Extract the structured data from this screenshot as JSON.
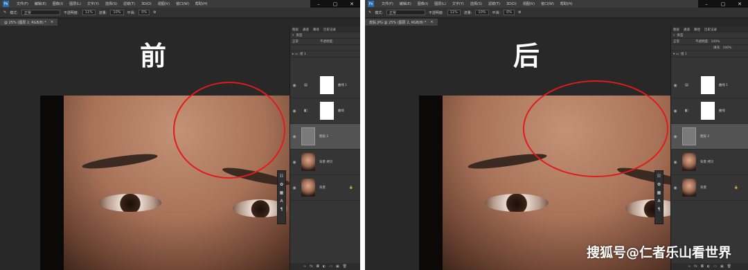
{
  "colors": {
    "accent_red": "#e11b1b",
    "workspace": "#282828",
    "panel": "#353535"
  },
  "left": {
    "menu": [
      "文件(F)",
      "编辑(E)",
      "图像(I)",
      "图层(L)",
      "文字(Y)",
      "选择(S)",
      "滤镜(T)",
      "3D(D)",
      "视图(V)",
      "窗口(W)",
      "帮助(H)"
    ],
    "opt_mode_label": "模式:",
    "opt_mode_value": "正常",
    "opt_opacity_label": "不透明度:",
    "opt_opacity_value": "11%",
    "opt_flow_label": "流量:",
    "opt_flow_value": "10%",
    "opt_smooth_label": "平滑:",
    "opt_smooth_value": "0%",
    "doc_tab": "@ 25% (图层 2, RGB/8) *",
    "title": "前",
    "panel_tabs": [
      "图层",
      "通道",
      "路径",
      "历史记录"
    ],
    "panel_kind": "类型",
    "panel_blend": "正常",
    "panel_opacity_label": "不透明度:",
    "group_name": "组 1",
    "layers": [
      "曲线 1",
      "曲线",
      "图层 2",
      "背景 拷贝",
      "背景"
    ]
  },
  "right": {
    "menu": [
      "文件(F)",
      "编辑(E)",
      "图像(I)",
      "图层(L)",
      "文字(Y)",
      "选择(S)",
      "滤镜(T)",
      "3D(D)",
      "视图(V)",
      "窗口(W)",
      "帮助(H)"
    ],
    "opt_mode_label": "模式:",
    "opt_mode_value": "正常",
    "opt_opacity_label": "不透明度:",
    "opt_opacity_value": "11%",
    "opt_flow_label": "流量:",
    "opt_flow_value": "10%",
    "opt_smooth_label": "平滑:",
    "opt_smooth_value": "0%",
    "doc_tab": "皮肤.JPG @ 25% (图层 2, RGB/8) *",
    "title": "后",
    "panel_tabs": [
      "图层",
      "通道",
      "路径",
      "历史记录"
    ],
    "panel_kind": "类型",
    "panel_blend": "正常",
    "panel_opacity_label": "不透明度:",
    "panel_opacity_value": "100%",
    "panel_fill_label": "填充:",
    "panel_fill_value": "100%",
    "group_name": "组 1",
    "layers": [
      "曲线 1",
      "曲线",
      "图层 2",
      "背景 拷贝",
      "背景"
    ]
  },
  "watermark": "搜狐号@仁者乐山看世界"
}
